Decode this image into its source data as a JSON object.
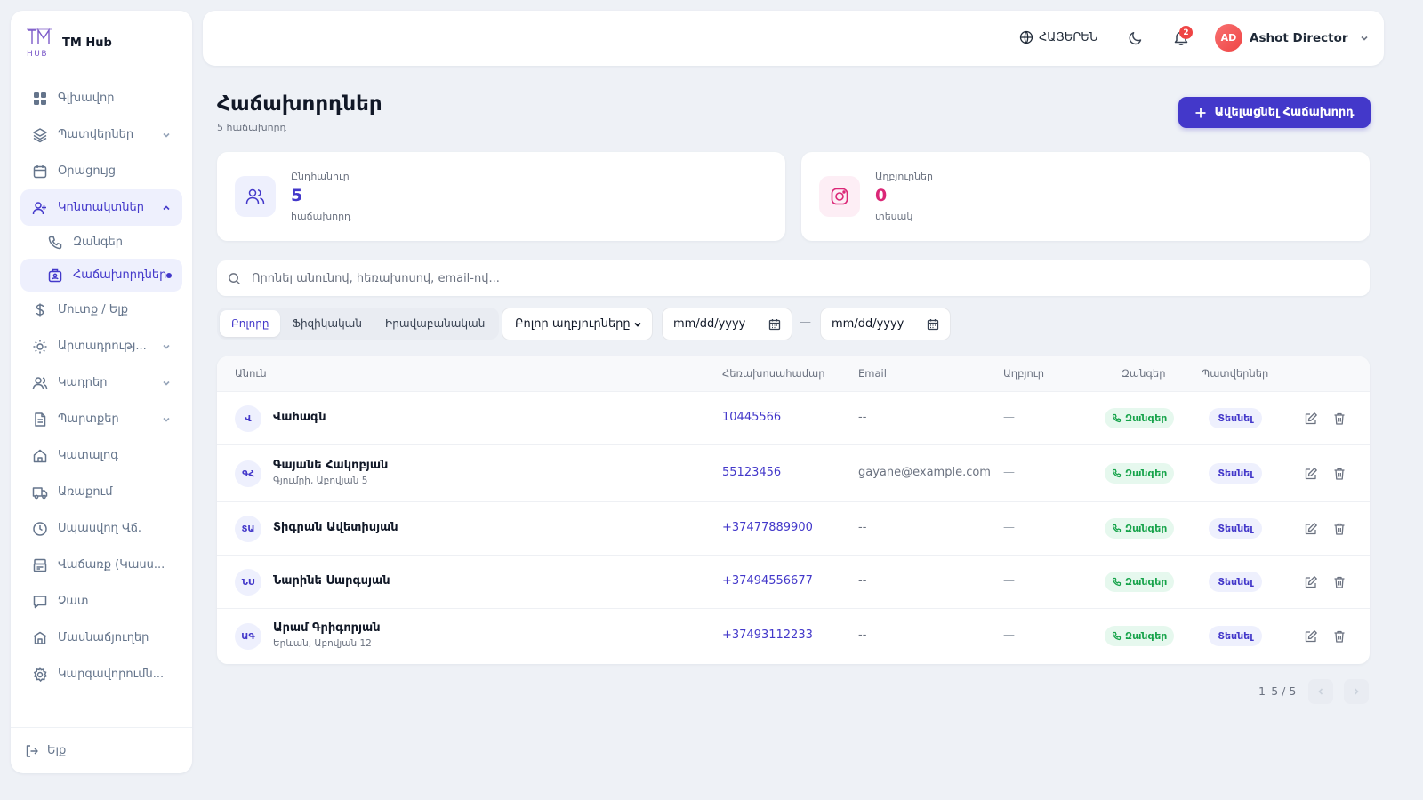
{
  "brand": {
    "name": "TM Hub"
  },
  "sidebar": {
    "items": [
      {
        "label": "Գլխավոր",
        "icon": "dashboard-icon"
      },
      {
        "label": "Պատվերներ",
        "icon": "layers-icon",
        "expandable": true
      },
      {
        "label": "Օրացույց",
        "icon": "calendar-icon"
      },
      {
        "label": "Կոնտակտներ",
        "icon": "contacts-icon",
        "expandable": true,
        "open": true
      },
      {
        "label": "Զանգեր",
        "icon": "phone-icon",
        "sub": true
      },
      {
        "label": "Հաճախորդներ",
        "icon": "client-card-icon",
        "sub": true,
        "active": true
      },
      {
        "label": "Մուտք / Ելք",
        "icon": "dollar-icon"
      },
      {
        "label": "Արտադրությ...",
        "icon": "production-icon",
        "expandable": true
      },
      {
        "label": "Կադրեր",
        "icon": "staff-icon",
        "expandable": true
      },
      {
        "label": "Պարտքեր",
        "icon": "document-icon",
        "expandable": true
      },
      {
        "label": "Կատալոգ",
        "icon": "home-icon"
      },
      {
        "label": "Առաքում",
        "icon": "truck-icon"
      },
      {
        "label": "Սպասվող Վճ.",
        "icon": "clock-icon"
      },
      {
        "label": "Վաճառք (Կասս...",
        "icon": "register-icon"
      },
      {
        "label": "Չատ",
        "icon": "chat-icon"
      },
      {
        "label": "Մասնաճյուղեր",
        "icon": "branch-icon"
      },
      {
        "label": "Կարգավորումն...",
        "icon": "settings-icon"
      }
    ],
    "logout_label": "Ելք"
  },
  "header": {
    "language": "ՀԱՅԵՐԵՆ",
    "notification_count": "2",
    "user_initials": "AD",
    "user_name": "Ashot Director"
  },
  "page": {
    "title": "Հաճախորդներ",
    "subtitle": "5 հաճախորդ",
    "add_button": "Ավելացնել Հաճախորդ"
  },
  "stats": [
    {
      "label": "Ընդհանուր",
      "value": "5",
      "unit": "հաճախորդ",
      "color": "#4338ca"
    },
    {
      "label": "Աղբյուրներ",
      "value": "0",
      "unit": "տեսակ",
      "color": "#db2777"
    }
  ],
  "search": {
    "placeholder": "Որոնել անունով, հեռախոսով, email-ով..."
  },
  "filters": {
    "segments": [
      "Բոլորը",
      "Ֆիզիկական",
      "Իրավաբանական"
    ],
    "source_select": "Բոլոր աղբյուրները",
    "date_from": "mm/dd/yyyy",
    "date_to": "mm/dd/yyyy",
    "date_separator": "—"
  },
  "table": {
    "columns": [
      "Անուն",
      "Հեռախոսահամար",
      "Email",
      "Աղբյուր",
      "Զանգեր",
      "Պատվերներ"
    ],
    "call_label": "Զանգեր",
    "view_label": "Տեսնել",
    "rows": [
      {
        "initials": "Վ",
        "name": "Վահագն",
        "address": "",
        "phone": "10445566",
        "email": "--",
        "source": "—"
      },
      {
        "initials": "ԳՀ",
        "name": "Գայանե Հակոբյան",
        "address": "Գյումրի, Աբովյան 5",
        "phone": "55123456",
        "email": "gayane@example.com",
        "source": "—"
      },
      {
        "initials": "ՏԱ",
        "name": "Տիգրան Ավետիսյան",
        "address": "",
        "phone": "+37477889900",
        "email": "--",
        "source": "—"
      },
      {
        "initials": "ՆՍ",
        "name": "Նարինե Սարգսյան",
        "address": "",
        "phone": "+37494556677",
        "email": "--",
        "source": "—"
      },
      {
        "initials": "ԱԳ",
        "name": "Արամ Գրիգորյան",
        "address": "Երևան, Աբովյան 12",
        "phone": "+37493112233",
        "email": "--",
        "source": "—"
      }
    ]
  },
  "pagination": {
    "text": "1–5 / 5"
  }
}
